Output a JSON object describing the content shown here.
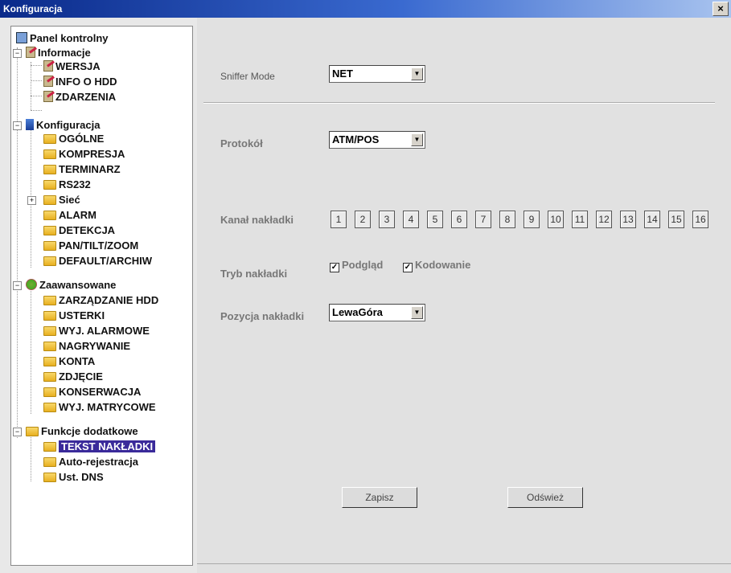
{
  "window": {
    "title": "Konfiguracja",
    "close_label": "×"
  },
  "tree": {
    "root": "Panel kontrolny",
    "informacje": {
      "label": "Informacje",
      "items": [
        "WERSJA",
        "INFO O HDD",
        "ZDARZENIA"
      ]
    },
    "konfiguracja": {
      "label": "Konfiguracja",
      "items": [
        "OGÓLNE",
        "KOMPRESJA",
        "TERMINARZ",
        "RS232",
        "Sieć",
        "ALARM",
        "DETEKCJA",
        "PAN/TILT/ZOOM",
        "DEFAULT/ARCHIW"
      ]
    },
    "zaawansowane": {
      "label": "Zaawansowane",
      "items": [
        "ZARZĄDZANIE HDD",
        "USTERKI",
        "WYJ. ALARMOWE",
        "NAGRYWANIE",
        "KONTA",
        "ZDJĘCIE",
        "KONSERWACJA",
        "WYJ. MATRYCOWE"
      ]
    },
    "funkcje": {
      "label": "Funkcje dodatkowe",
      "items": [
        "TEKST NAKŁADKI",
        "Auto-rejestracja",
        "Ust. DNS"
      ]
    },
    "selected": "TEKST NAKŁADKI"
  },
  "form": {
    "sniffer_label": "Sniffer Mode",
    "sniffer_value": "NET",
    "protokol_label": "Protokół",
    "protokol_value": "ATM/POS",
    "kanal_label": "Kanał nakładki",
    "channels": [
      "1",
      "2",
      "3",
      "4",
      "5",
      "6",
      "7",
      "8",
      "9",
      "10",
      "11",
      "12",
      "13",
      "14",
      "15",
      "16"
    ],
    "tryb_label": "Tryb nakładki",
    "podglad_label": "Podgląd",
    "podglad_checked": true,
    "kodowanie_label": "Kodowanie",
    "kodowanie_checked": true,
    "pozycja_label": "Pozycja nakładki",
    "pozycja_value": "LewaGóra",
    "save_label": "Zapisz",
    "refresh_label": "Odśwież"
  }
}
